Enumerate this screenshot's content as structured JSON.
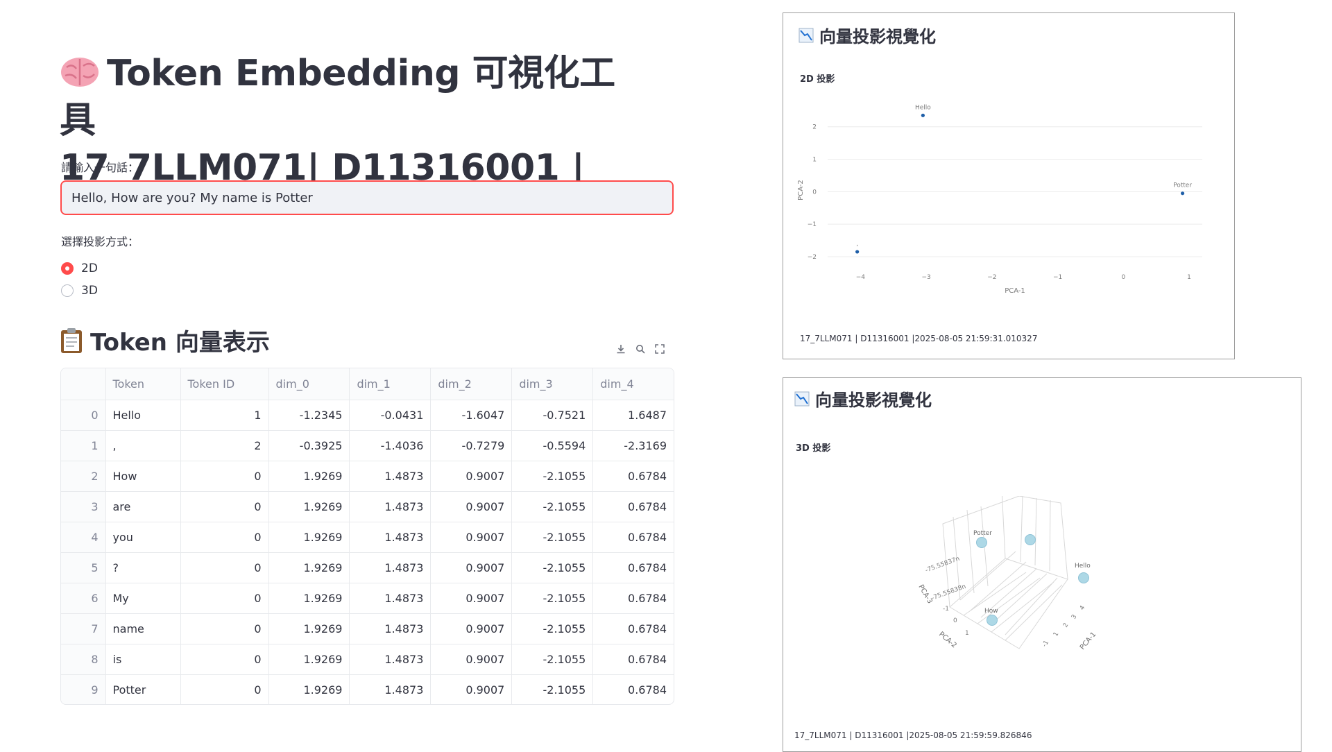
{
  "header": {
    "title_line1": "Token Embedding 可視化工具",
    "title_line2": "17_7LLM071| D11316001 |"
  },
  "input": {
    "label": "請輸入一句話：",
    "value": "Hello, How are you? My name is Potter"
  },
  "projection": {
    "label": "選擇投影方式：",
    "options": [
      {
        "label": "2D",
        "selected": true
      },
      {
        "label": "3D",
        "selected": false
      }
    ]
  },
  "table_section": {
    "title": "Token 向量表示",
    "toolbar": [
      "download-icon",
      "search-icon",
      "fullscreen-icon"
    ],
    "columns": [
      "",
      "Token",
      "Token ID",
      "dim_0",
      "dim_1",
      "dim_2",
      "dim_3",
      "dim_4"
    ],
    "rows": [
      [
        "0",
        "Hello",
        "1",
        "-1.2345",
        "-0.0431",
        "-1.6047",
        "-0.7521",
        "1.6487"
      ],
      [
        "1",
        ",",
        "2",
        "-0.3925",
        "-1.4036",
        "-0.7279",
        "-0.5594",
        "-2.3169"
      ],
      [
        "2",
        "How",
        "0",
        "1.9269",
        "1.4873",
        "0.9007",
        "-2.1055",
        "0.6784"
      ],
      [
        "3",
        "are",
        "0",
        "1.9269",
        "1.4873",
        "0.9007",
        "-2.1055",
        "0.6784"
      ],
      [
        "4",
        "you",
        "0",
        "1.9269",
        "1.4873",
        "0.9007",
        "-2.1055",
        "0.6784"
      ],
      [
        "5",
        "?",
        "0",
        "1.9269",
        "1.4873",
        "0.9007",
        "-2.1055",
        "0.6784"
      ],
      [
        "6",
        "My",
        "0",
        "1.9269",
        "1.4873",
        "0.9007",
        "-2.1055",
        "0.6784"
      ],
      [
        "7",
        "name",
        "0",
        "1.9269",
        "1.4873",
        "0.9007",
        "-2.1055",
        "0.6784"
      ],
      [
        "8",
        "is",
        "0",
        "1.9269",
        "1.4873",
        "0.9007",
        "-2.1055",
        "0.6784"
      ],
      [
        "9",
        "Potter",
        "0",
        "1.9269",
        "1.4873",
        "0.9007",
        "-2.1055",
        "0.6784"
      ]
    ]
  },
  "panel_2d": {
    "title": "向量投影視覺化",
    "subtitle": "2D 投影",
    "footer": "17_7LLM071 | D11316001 |2025-08-05 21:59:31.010327"
  },
  "panel_3d": {
    "title": "向量投影視覺化",
    "subtitle": "3D 投影",
    "footer": "17_7LLM071 | D11316001 |2025-08-05 21:59:59.826846",
    "axis_labels": [
      "PCA-1",
      "PCA-2",
      "PCA-3"
    ],
    "tick_texts": [
      "-75.55837n",
      "-75.55838n",
      "-1",
      "0",
      "1",
      "4",
      "3",
      "2",
      "1",
      "-1"
    ],
    "point_labels": [
      "Potter",
      "Hello",
      "How"
    ]
  },
  "colors": {
    "accent": "#ff4b4b",
    "point_2d": "#1f5fa8",
    "point_3d": "#add8e6"
  },
  "chart_data": [
    {
      "type": "scatter",
      "title": "",
      "xlabel": "PCA-1",
      "ylabel": "PCA-2",
      "xlim": [
        -4.5,
        1.2
      ],
      "ylim": [
        -2.3,
        2.4
      ],
      "xticks": [
        -4,
        -3,
        -2,
        -1,
        0,
        1
      ],
      "yticks": [
        -2,
        -1,
        0,
        1,
        2
      ],
      "tick_labels_x": [
        "−4",
        "−3",
        "−2",
        "−1",
        "0",
        "1"
      ],
      "tick_labels_y": [
        "−2",
        "−1",
        "0",
        "1",
        "2"
      ],
      "grid": true,
      "points": [
        {
          "label": "Hello",
          "x": -3.05,
          "y": 2.35
        },
        {
          "label": ",",
          "x": -4.05,
          "y": -1.85
        },
        {
          "label": "Potter",
          "x": 0.9,
          "y": -0.05
        }
      ]
    }
  ]
}
